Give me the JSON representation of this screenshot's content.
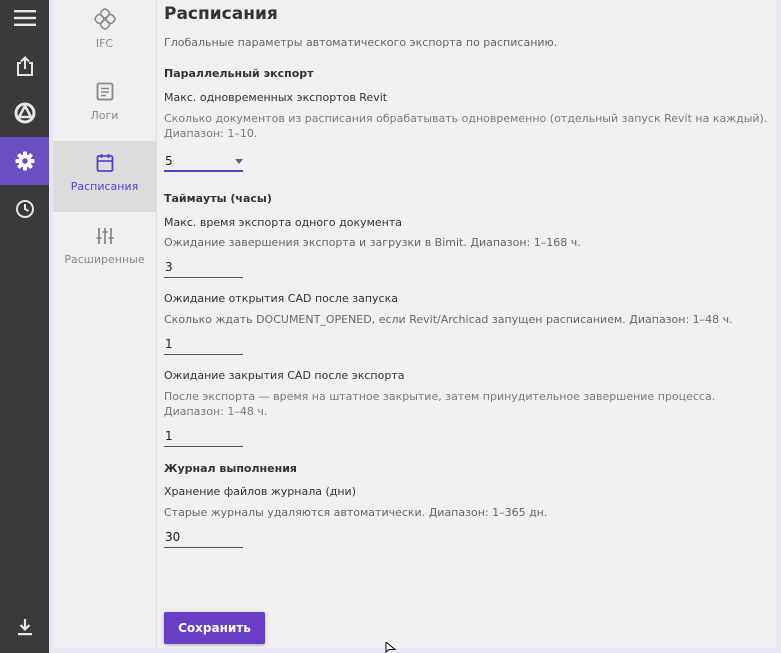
{
  "rail": {
    "items": [
      {
        "icon": "menu-icon"
      },
      {
        "icon": "share-export-icon"
      },
      {
        "icon": "bimit-logo-icon"
      },
      {
        "icon": "gear-icon",
        "active": true
      },
      {
        "icon": "clock-icon"
      },
      {
        "icon": "download-icon"
      }
    ],
    "active_color": "#6a4fc2"
  },
  "subnav": {
    "items": [
      {
        "label": "IFC",
        "icon": "ifc-icon"
      },
      {
        "label": "Логи",
        "icon": "log-document-icon"
      },
      {
        "label": "Расписания",
        "icon": "calendar-icon",
        "active": true
      },
      {
        "label": "Расширенные",
        "icon": "sliders-icon"
      }
    ]
  },
  "main": {
    "title": "Расписания",
    "subtitle": "Глобальные параметры автоматического экспорта по расписанию.",
    "parallel": {
      "section": "Параллельный экспорт",
      "label": "Макс. одновременных экспортов Revit",
      "hint": "Сколько документов из расписания обрабатывать одновременно (отдельный запуск Revit на каждый). Диапазон: 1–10.",
      "value": "5"
    },
    "timeouts": {
      "section": "Таймауты (часы)",
      "export_label": "Макс. время экспорта одного документа",
      "export_hint": "Ожидание завершения экспорта и загрузки в Bimit. Диапазон: 1–168 ч.",
      "export_value": "3",
      "open_label": "Ожидание открытия CAD после запуска",
      "open_hint": "Сколько ждать DOCUMENT_OPENED, если Revit/Archicad запущен расписанием. Диапазон: 1–48 ч.",
      "open_value": "1",
      "close_label": "Ожидание закрытия CAD после экспорта",
      "close_hint": "После экспорта — время на штатное закрытие, затем принудительное завершение процесса. Диапазон: 1–48 ч.",
      "close_value": "1"
    },
    "journal": {
      "section": "Журнал выполнения",
      "label": "Хранение файлов журнала (дни)",
      "hint": "Старые журналы удаляются автоматически. Диапазон: 1–365 дн.",
      "value": "30"
    },
    "save_label": "Сохранить",
    "accent_color": "#6a3fc8"
  }
}
